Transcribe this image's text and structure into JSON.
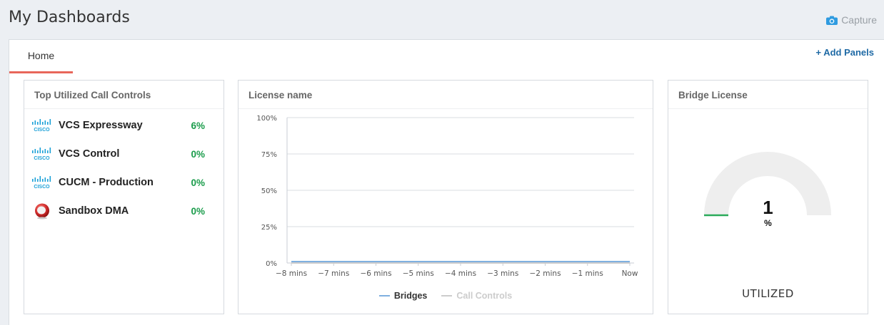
{
  "header": {
    "title": "My Dashboards",
    "capture_label": "Capture",
    "capture_icon": "camera-icon"
  },
  "tabs": [
    {
      "label": "Home",
      "active": true
    }
  ],
  "add_panels_label": "+ Add Panels",
  "colors": {
    "tab_accent": "#e8665a",
    "link": "#1f6aa5",
    "pct_green": "#1a9c4b",
    "bridges_line": "#7fb0e0",
    "call_controls_line": "#cccccc",
    "gauge_track": "#eeeeee",
    "gauge_fill": "#2aaa5a"
  },
  "top_call_controls": {
    "title": "Top Utilized Call Controls",
    "items": [
      {
        "name": "VCS Expressway",
        "percent": "6%",
        "icon": "cisco-logo-icon"
      },
      {
        "name": "VCS Control",
        "percent": "0%",
        "icon": "cisco-logo-icon"
      },
      {
        "name": "CUCM - Production",
        "percent": "0%",
        "icon": "cisco-logo-icon"
      },
      {
        "name": "Sandbox DMA",
        "percent": "0%",
        "icon": "polycom-logo-icon"
      }
    ]
  },
  "license_panel": {
    "title": "License name"
  },
  "chart_data": {
    "type": "line",
    "categories": [
      "−8 mins",
      "−7 mins",
      "−6 mins",
      "−5 mins",
      "−4 mins",
      "−3 mins",
      "−2 mins",
      "−1 mins",
      "Now"
    ],
    "y_ticks": [
      "0%",
      "25%",
      "50%",
      "75%",
      "100%"
    ],
    "ylim": [
      0,
      100
    ],
    "series": [
      {
        "name": "Bridges",
        "values": [
          1,
          1,
          1,
          1,
          1,
          1,
          1,
          1,
          1
        ]
      },
      {
        "name": "Call Controls",
        "values": [
          0,
          0,
          0,
          0,
          0,
          0,
          0,
          0,
          0
        ]
      }
    ],
    "legend": "bottom",
    "grid": true
  },
  "bridge_license": {
    "title": "Bridge License",
    "value": 1,
    "value_text": "1",
    "unit": "%",
    "label": "UTILIZED"
  }
}
